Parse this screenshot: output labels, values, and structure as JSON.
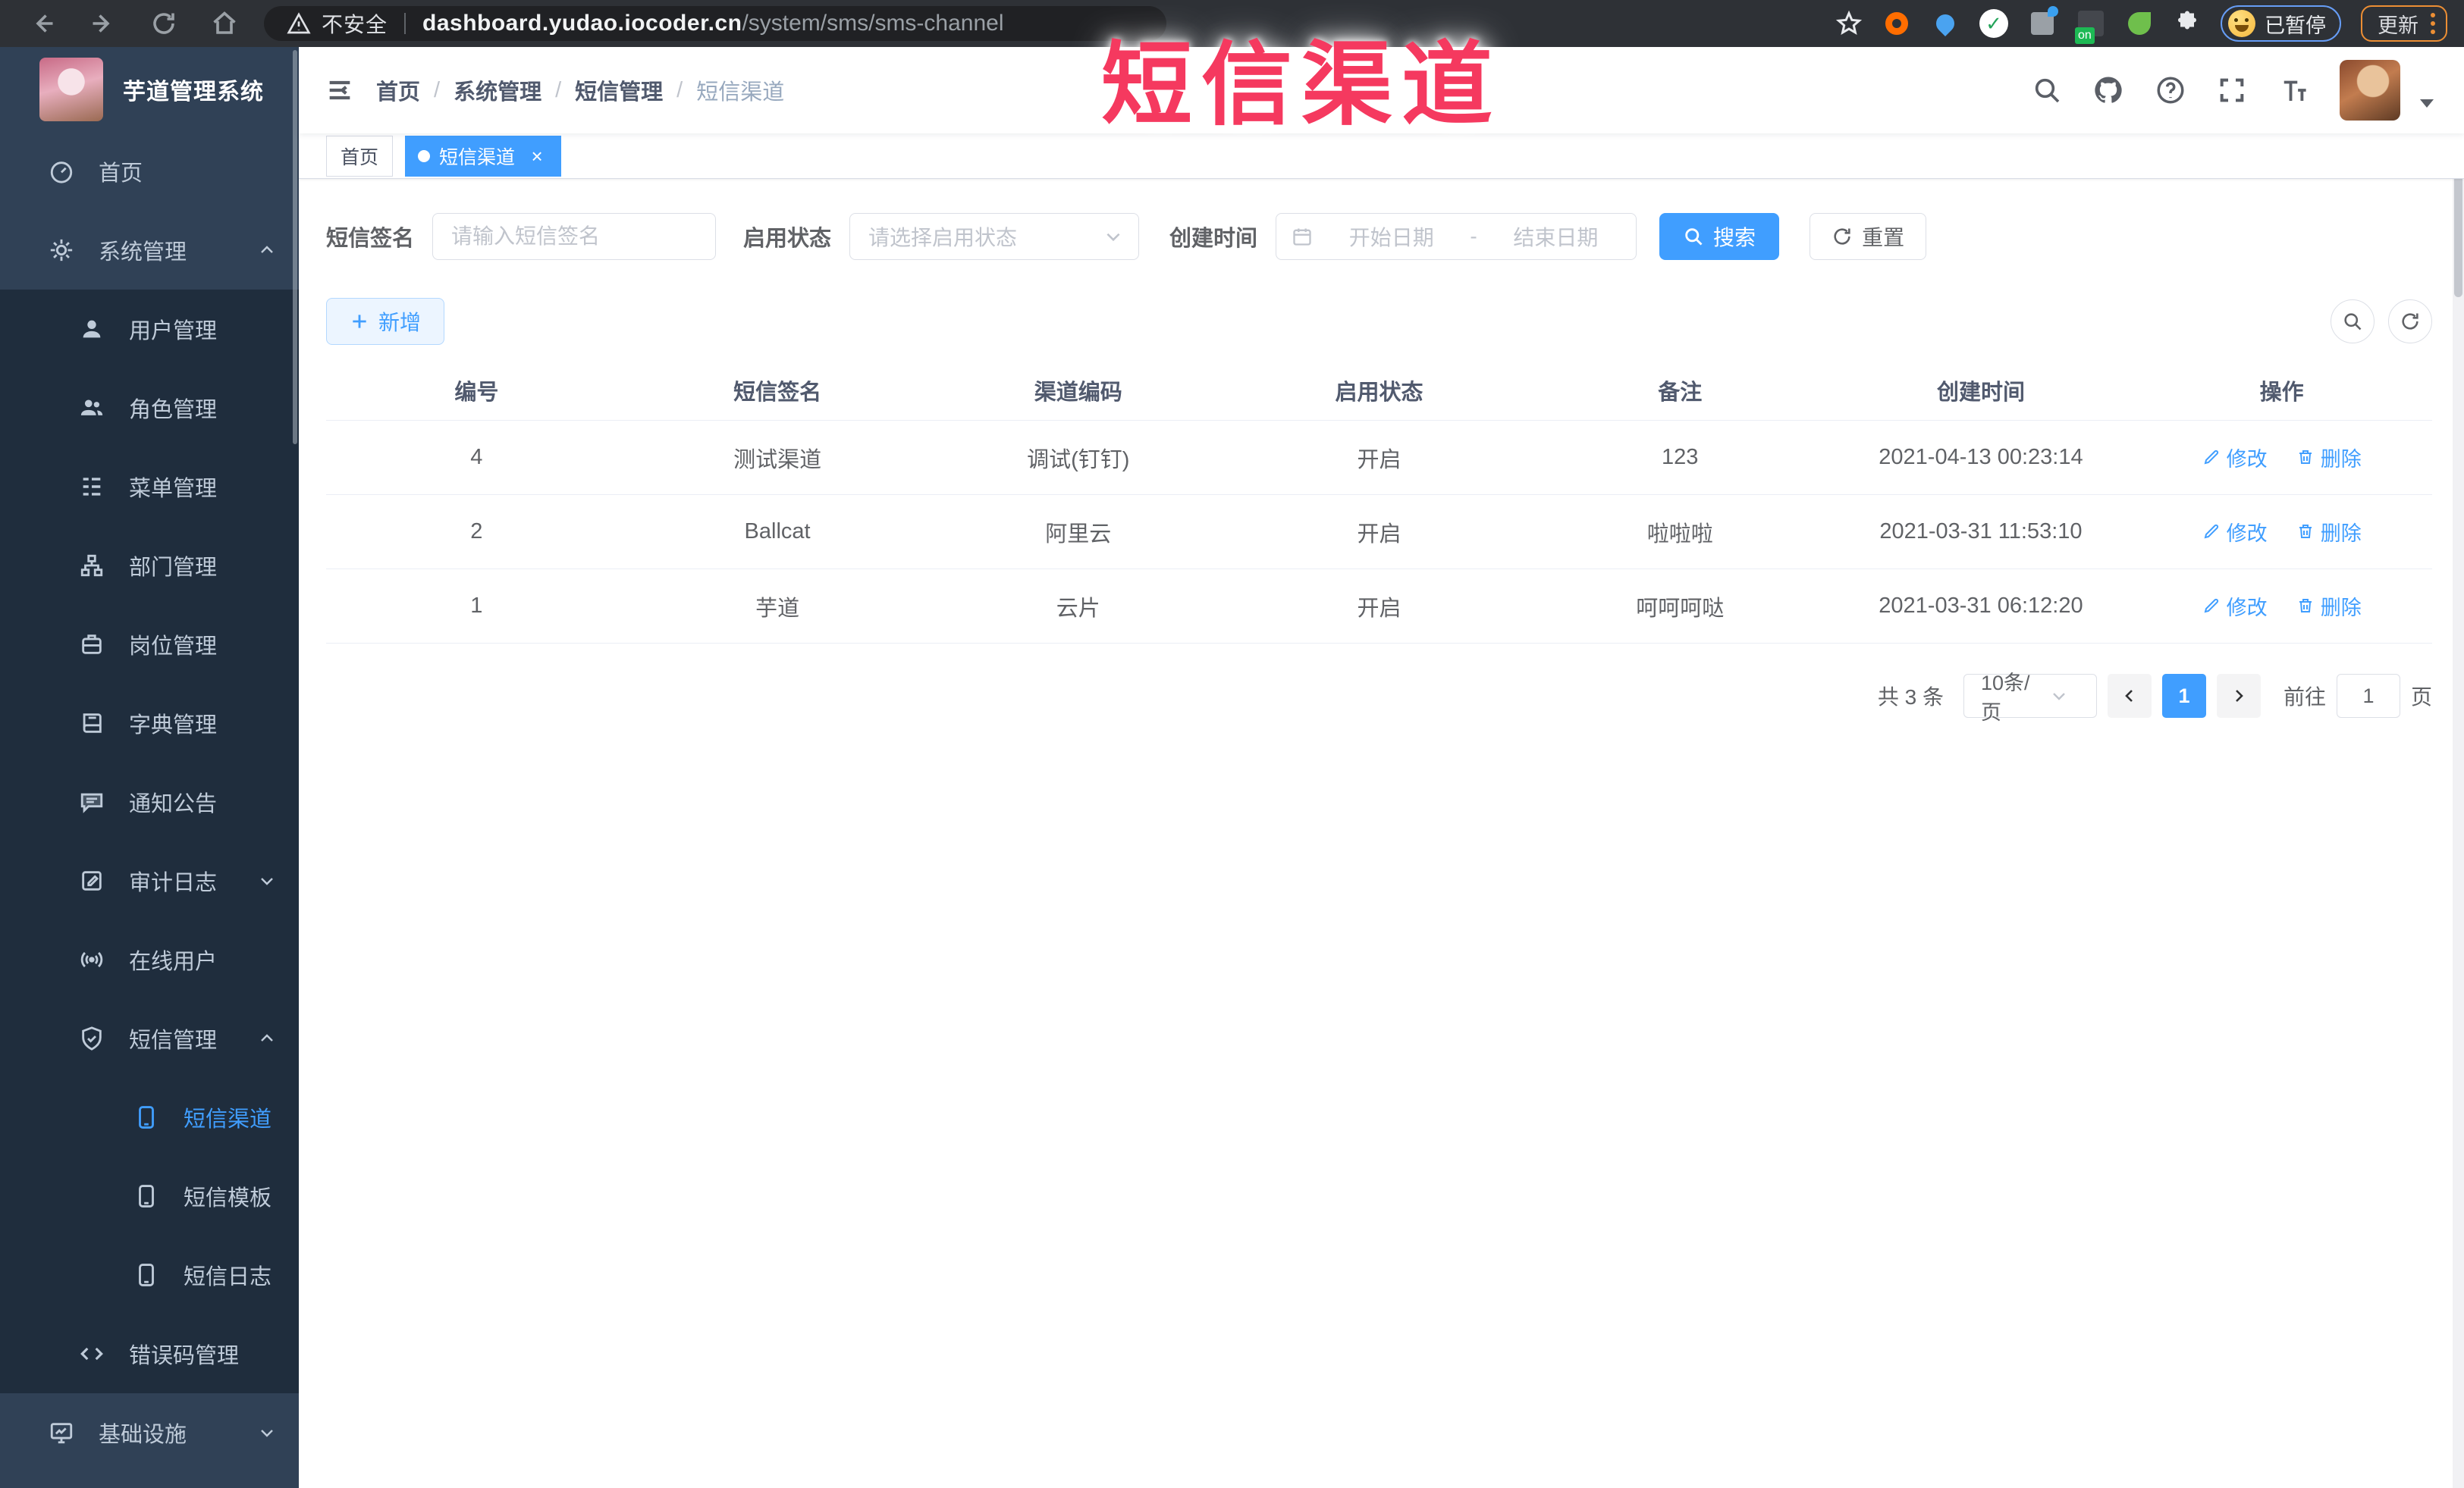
{
  "colors": {
    "accent": "#409EFF",
    "overlay_red": "#f5395f",
    "sidebar_bg": "#304156",
    "submenu_bg": "#1f2d3d"
  },
  "browser": {
    "security_label": "不安全",
    "url_domain": "dashboard.yudao.iocoder.cn",
    "url_path": "/system/sms/sms-channel",
    "paused_label": "已暂停",
    "update_label": "更新"
  },
  "overlay_title": "短信渠道",
  "sidebar": {
    "logo_title": "芋道管理系统",
    "items": {
      "home": "首页",
      "system": "系统管理",
      "user": "用户管理",
      "role": "角色管理",
      "menu": "菜单管理",
      "dept": "部门管理",
      "post": "岗位管理",
      "dict": "字典管理",
      "notice": "通知公告",
      "audit": "审计日志",
      "online": "在线用户",
      "sms": "短信管理",
      "smsChannel": "短信渠道",
      "smsTemplate": "短信模板",
      "smsLog": "短信日志",
      "errorCode": "错误码管理",
      "infra": "基础设施"
    }
  },
  "breadcrumb": [
    "首页",
    "系统管理",
    "短信管理",
    "短信渠道"
  ],
  "tabs": {
    "home": "首页",
    "current": "短信渠道"
  },
  "filters": {
    "signature_label": "短信签名",
    "signature_placeholder": "请输入短信签名",
    "status_label": "启用状态",
    "status_placeholder": "请选择启用状态",
    "time_label": "创建时间",
    "start_placeholder": "开始日期",
    "range_separator": "-",
    "end_placeholder": "结束日期",
    "search_label": "搜索",
    "reset_label": "重置"
  },
  "toolbar": {
    "add_label": "新增"
  },
  "table": {
    "headers": [
      "编号",
      "短信签名",
      "渠道编码",
      "启用状态",
      "备注",
      "创建时间",
      "操作"
    ],
    "ops": {
      "edit": "修改",
      "delete": "删除"
    },
    "rows": [
      {
        "id": "4",
        "signature": "测试渠道",
        "code": "调试(钉钉)",
        "status": "开启",
        "remark": "123",
        "created": "2021-04-13 00:23:14"
      },
      {
        "id": "2",
        "signature": "Ballcat",
        "code": "阿里云",
        "status": "开启",
        "remark": "啦啦啦",
        "created": "2021-03-31 11:53:10"
      },
      {
        "id": "1",
        "signature": "芋道",
        "code": "云片",
        "status": "开启",
        "remark": "呵呵呵哒",
        "created": "2021-03-31 06:12:20"
      }
    ]
  },
  "pagination": {
    "total": "共 3 条",
    "size": "10条/页",
    "page": "1",
    "goto_label": "前往",
    "goto_value": "1",
    "unit": "页"
  }
}
